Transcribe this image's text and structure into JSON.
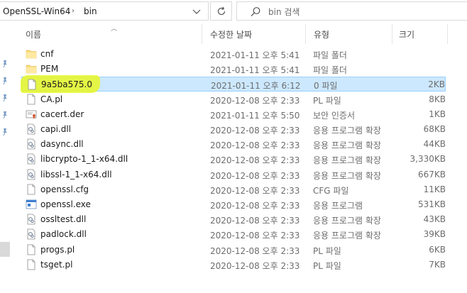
{
  "address": {
    "crumbs": [
      "OpenSSL-Win64",
      "bin"
    ],
    "separator": "›"
  },
  "search": {
    "placeholder": "bin 검색"
  },
  "columns": {
    "name": "이름",
    "date": "수정한 날짜",
    "type": "유형",
    "size": "크기"
  },
  "files": [
    {
      "name": "cnf",
      "date": "2021-01-11 오후 5:41",
      "type": "파일 폴더",
      "size": "",
      "icon": "folder-icon"
    },
    {
      "name": "PEM",
      "date": "2021-01-11 오후 5:41",
      "type": "파일 폴더",
      "size": "",
      "icon": "folder-icon"
    },
    {
      "name": "9a5ba575.0",
      "date": "2021-01-11 오후 6:12",
      "type": "0 파일",
      "size": "2KB",
      "icon": "file-icon",
      "selected": true
    },
    {
      "name": "CA.pl",
      "date": "2020-12-08 오후 2:33",
      "type": "PL 파일",
      "size": "8KB",
      "icon": "file-icon"
    },
    {
      "name": "cacert.der",
      "date": "2021-01-11 오후 5:50",
      "type": "보안 인증서",
      "size": "1KB",
      "icon": "certificate-icon"
    },
    {
      "name": "capi.dll",
      "date": "2020-12-08 오후 2:33",
      "type": "응용 프로그램 확장",
      "size": "68KB",
      "icon": "dll-icon"
    },
    {
      "name": "dasync.dll",
      "date": "2020-12-08 오후 2:33",
      "type": "응용 프로그램 확장",
      "size": "44KB",
      "icon": "dll-icon"
    },
    {
      "name": "libcrypto-1_1-x64.dll",
      "date": "2020-12-08 오후 2:33",
      "type": "응용 프로그램 확장",
      "size": "3,330KB",
      "icon": "dll-icon"
    },
    {
      "name": "libssl-1_1-x64.dll",
      "date": "2020-12-08 오후 2:33",
      "type": "응용 프로그램 확장",
      "size": "667KB",
      "icon": "dll-icon"
    },
    {
      "name": "openssl.cfg",
      "date": "2020-12-08 오후 2:33",
      "type": "CFG 파일",
      "size": "11KB",
      "icon": "file-icon"
    },
    {
      "name": "openssl.exe",
      "date": "2020-12-08 오후 2:33",
      "type": "응용 프로그램",
      "size": "531KB",
      "icon": "exe-icon"
    },
    {
      "name": "ossltest.dll",
      "date": "2020-12-08 오후 2:33",
      "type": "응용 프로그램 확장",
      "size": "43KB",
      "icon": "dll-icon"
    },
    {
      "name": "padlock.dll",
      "date": "2020-12-08 오후 2:33",
      "type": "응용 프로그램 확장",
      "size": "39KB",
      "icon": "dll-icon"
    },
    {
      "name": "progs.pl",
      "date": "2020-12-08 오후 2:33",
      "type": "PL 파일",
      "size": "6KB",
      "icon": "file-icon"
    },
    {
      "name": "tsget.pl",
      "date": "2020-12-08 오후 2:33",
      "type": "PL 파일",
      "size": "7KB",
      "icon": "file-icon"
    }
  ],
  "colors": {
    "selection_bg": "#cce8ff",
    "selection_border": "#99d1ff",
    "highlighter": "#e8f724",
    "folder": "#f8d775"
  }
}
